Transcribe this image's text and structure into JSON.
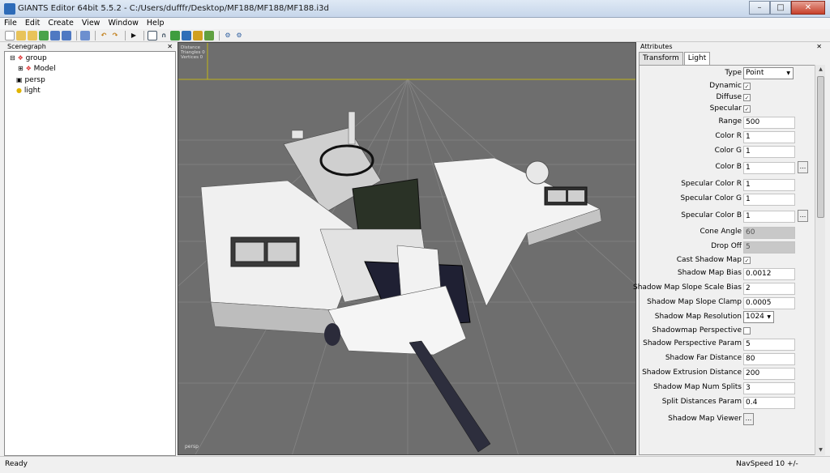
{
  "window": {
    "title": "GIANTS Editor 64bit 5.5.2 - C:/Users/dufffr/Desktop/MF188/MF188/MF188.i3d"
  },
  "menu": [
    "File",
    "Edit",
    "Create",
    "View",
    "Window",
    "Help"
  ],
  "scenegraph": {
    "title": "Scenegraph",
    "nodes": [
      {
        "label": "group",
        "depth": 0
      },
      {
        "label": "Model",
        "depth": 1
      },
      {
        "label": "persp",
        "depth": 0
      },
      {
        "label": "light",
        "depth": 0
      }
    ]
  },
  "viewport": {
    "info": [
      "Distance",
      "Triangles 0",
      "Vertices 0"
    ],
    "camera": "persp"
  },
  "attributes": {
    "title": "Attributes",
    "tabs": [
      "Transform",
      "Light"
    ],
    "type_label": "Type",
    "type_value": "Point",
    "dynamic": "Dynamic",
    "diffuse": "Diffuse",
    "specular": "Specular",
    "range_label": "Range",
    "range": "500",
    "color_r_label": "Color R",
    "color_r": "1",
    "color_g_label": "Color G",
    "color_g": "1",
    "color_b_label": "Color B",
    "color_b": "1",
    "spec_r_label": "Specular Color R",
    "spec_r": "1",
    "spec_g_label": "Specular Color G",
    "spec_g": "1",
    "spec_b_label": "Specular Color B",
    "spec_b": "1",
    "cone_label": "Cone Angle",
    "cone": "60",
    "dropoff_label": "Drop Off",
    "dropoff": "5",
    "cast_shadow": "Cast Shadow Map",
    "bias_label": "Shadow Map Bias",
    "bias": "0.0012",
    "slope_label": "Shadow Map Slope Scale Bias",
    "slope": "2",
    "clamp_label": "Shadow Map Slope Clamp",
    "clamp": "0.0005",
    "res_label": "Shadow Map Resolution",
    "res": "1024",
    "persp_label": "Shadowmap Perspective",
    "param_label": "Shadow Perspective Param",
    "param": "5",
    "far_label": "Shadow Far Distance",
    "far": "80",
    "ext_label": "Shadow Extrusion Distance",
    "ext": "200",
    "splits_label": "Shadow Map Num Splits",
    "splits": "3",
    "splitd_label": "Split Distances Param",
    "splitd": "0.4",
    "viewer_label": "Shadow Map Viewer"
  },
  "status": {
    "left": "Ready",
    "right": "NavSpeed 10 +/-"
  }
}
